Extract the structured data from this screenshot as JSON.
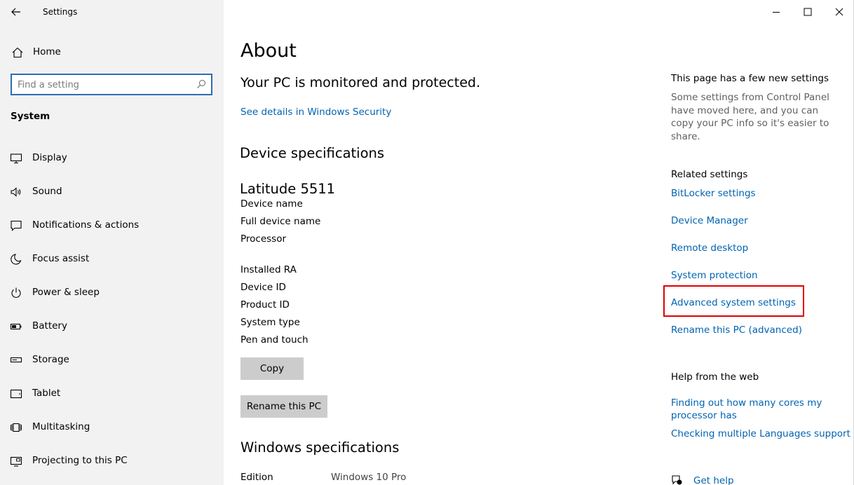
{
  "app": {
    "title": "Settings"
  },
  "sidebar": {
    "home_label": "Home",
    "search_placeholder": "Find a setting",
    "section_label": "System",
    "items": [
      {
        "label": "Display",
        "icon": "display-icon"
      },
      {
        "label": "Sound",
        "icon": "sound-icon"
      },
      {
        "label": "Notifications & actions",
        "icon": "notifications-icon"
      },
      {
        "label": "Focus assist",
        "icon": "moon-icon"
      },
      {
        "label": "Power & sleep",
        "icon": "power-icon"
      },
      {
        "label": "Battery",
        "icon": "battery-icon"
      },
      {
        "label": "Storage",
        "icon": "storage-icon"
      },
      {
        "label": "Tablet",
        "icon": "tablet-icon"
      },
      {
        "label": "Multitasking",
        "icon": "multitasking-icon"
      },
      {
        "label": "Projecting to this PC",
        "icon": "projecting-icon"
      }
    ]
  },
  "main": {
    "title": "About",
    "protection_status": "Your PC is monitored and protected.",
    "security_link": "See details in Windows Security",
    "device_specs_heading": "Device specifications",
    "device_model": "Latitude 5511",
    "specs": [
      {
        "label": "Device name",
        "value": ""
      },
      {
        "label": "Full device name",
        "value": ""
      },
      {
        "label": "Processor",
        "value": ""
      },
      {
        "label": "Installed RA",
        "value": ""
      },
      {
        "label": "Device ID",
        "value": ""
      },
      {
        "label": "Product ID",
        "value": ""
      },
      {
        "label": "System type",
        "value": ""
      },
      {
        "label": "Pen and touch",
        "value": ""
      }
    ],
    "copy_button": "Copy",
    "rename_button": "Rename this PC",
    "windows_specs_heading": "Windows specifications",
    "windows_specs": [
      {
        "label": "Edition",
        "value": "Windows 10 Pro"
      }
    ]
  },
  "right": {
    "new_settings_heading": "This page has a few new settings",
    "new_settings_text": "Some settings from Control Panel have moved here, and you can copy your PC info so it's easier to share.",
    "related_heading": "Related settings",
    "related_links": [
      "BitLocker settings",
      "Device Manager",
      "Remote desktop",
      "System protection",
      "Advanced system settings",
      "Rename this PC (advanced)"
    ],
    "help_heading": "Help from the web",
    "help_links": [
      "Finding out how many cores my processor has",
      "Checking multiple Languages support"
    ],
    "get_help": "Get help"
  },
  "colors": {
    "accent_link": "#0063b1",
    "highlight_box": "#e00000",
    "search_border": "#2d6cb5",
    "sidebar_bg": "#f2f2f2"
  }
}
